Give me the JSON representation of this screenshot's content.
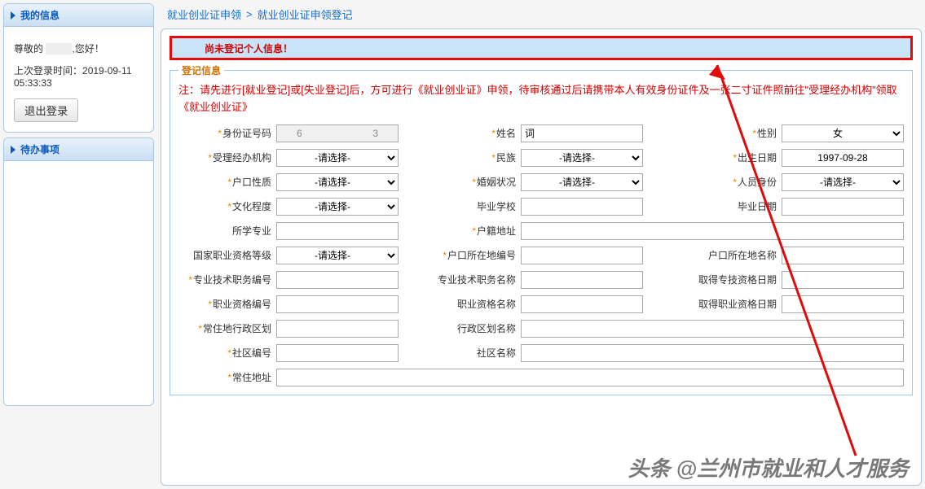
{
  "sidebar": {
    "myinfo_title": "我的信息",
    "greeting_prefix": "尊敬的",
    "greeting_name": "       ",
    "greeting_suffix": ",您好！",
    "last_login_label": "上次登录时间：",
    "last_login_time": "2019-09-11 05:33:33",
    "logout_label": "退出登录",
    "todo_title": "待办事项"
  },
  "breadcrumb": {
    "step1": "就业创业证申领",
    "sep": ">",
    "step2": "就业创业证申领登记"
  },
  "alert": "尚未登记个人信息！",
  "legend": "登记信息",
  "note": "注：请先进行[就业登记]或[失业登记]后，方可进行《就业创业证》申领，待审核通过后请携带本人有效身份证件及一张二寸证件照前往\"受理经办机构\"领取《就业创业证》",
  "labels": {
    "id_no": "身份证号码",
    "name": "姓名",
    "gender": "性别",
    "agency": "受理经办机构",
    "ethnic": "民族",
    "birth": "出生日期",
    "hukou_type": "户口性质",
    "marital": "婚姻状况",
    "personnel": "人员身份",
    "edu": "文化程度",
    "grad_school": "毕业学校",
    "grad_date": "毕业日期",
    "major": "所学专业",
    "hukou_addr": "户籍地址",
    "vocation_level": "国家职业资格等级",
    "hukou_code_label": "户口所在地编号",
    "hukou_name_label": "户口所在地名称",
    "pro_tech_code": "专业技术职务编号",
    "pro_tech_name": "专业技术职务名称",
    "pro_tech_date": "取得专技资格日期",
    "voc_code": "职业资格编号",
    "voc_name": "职业资格名称",
    "voc_date": "取得职业资格日期",
    "res_division": "常住地行政区划",
    "division_name": "行政区划名称",
    "community_code": "社区编号",
    "community_name": "社区名称",
    "res_addr": "常住地址"
  },
  "values": {
    "id_no": "6                          3",
    "name": "词         ",
    "gender": "女",
    "birth": "1997-09-28"
  },
  "select_placeholder": "-请选择-",
  "watermark": "头条 @兰州市就业和人才服务"
}
